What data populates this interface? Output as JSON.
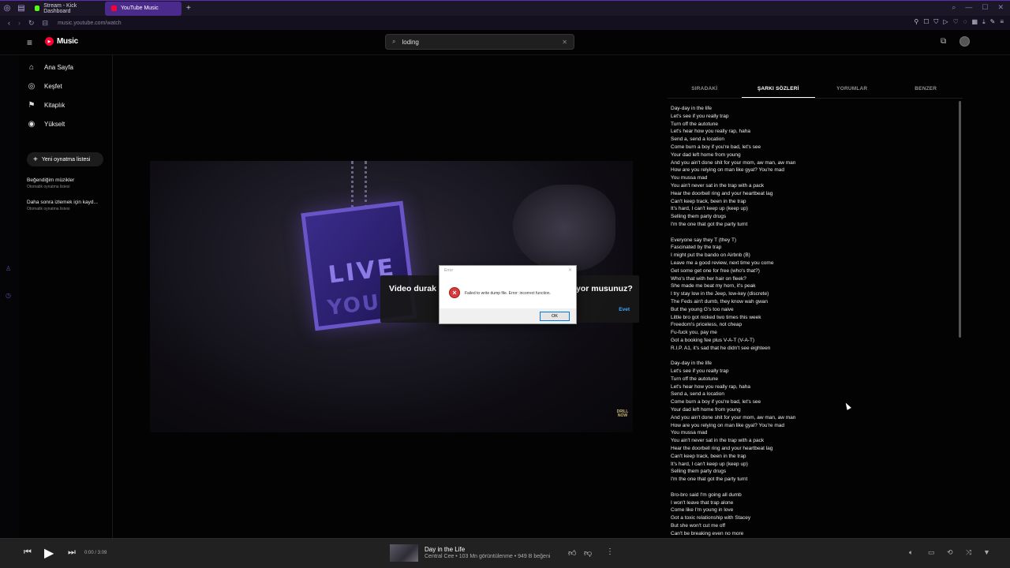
{
  "browser": {
    "tabs": [
      {
        "label": "Stream - Kick Dashboard",
        "color": "#53fc18",
        "active": false
      },
      {
        "label": "YouTube Music",
        "color": "#ff0033",
        "active": true
      }
    ],
    "url": "music.youtube.com/watch"
  },
  "header": {
    "logo_text": "Music",
    "search_value": "loding"
  },
  "sidebar": {
    "items": [
      {
        "label": "Ana Sayfa",
        "icon": "home-icon"
      },
      {
        "label": "Keşfet",
        "icon": "compass-icon"
      },
      {
        "label": "Kitaplık",
        "icon": "library-icon"
      },
      {
        "label": "Yükselt",
        "icon": "upgrade-icon"
      }
    ],
    "new_playlist": "Yeni oynatma listesi",
    "playlists": [
      {
        "title": "Beğendiğim müzikler",
        "subtitle": "Otomatik oynatma listesi"
      },
      {
        "title": "Daha sonra izlemek için kayd...",
        "subtitle": "Otomatik oynatma listesi"
      }
    ]
  },
  "video": {
    "pendant_line1": "LIVE",
    "pendant_line2": "YOU",
    "watermark": "DRILL NOW"
  },
  "pause_overlay": {
    "text_left": "Video durak",
    "text_right": "yor musunuz?",
    "confirm": "Evet"
  },
  "error_dialog": {
    "title": "Error",
    "message": "Failed to write dump file. Error: incorrect function.",
    "ok": "OK"
  },
  "panel": {
    "tabs": [
      "SIRADAKİ",
      "ŞARKI SÖZLERİ",
      "YORUMLAR",
      "BENZER"
    ],
    "active_tab": 1,
    "lyrics": [
      "Day-day in the life",
      "Let's see if you really trap",
      "Turn off the autotune",
      "Let's hear how you really rap, haha",
      "Send a, send a location",
      "Come burn a boy if you're bad, let's see",
      "Your dad left home from young",
      "And you ain't done shit for your mom, aw man, aw man",
      "How are you relying on man like gyal? You're mad",
      "You mussa mad",
      "You ain't never sat in the trap with a pack",
      "Hear the doorbell ring and your heartbeat lag",
      "Can't keep track, been in the trap",
      "It's hard, I can't keep up (keep up)",
      "Selling them party drugs",
      "I'm the one that got the party turnt",
      "",
      "Everyone say they T (they T)",
      "Fascinated by the trap",
      "I might put the bando on Airbnb (B)",
      "Leave me a good review, next time you come",
      "Get some get one for free (who's that?)",
      "Who's that with her hair on fleek?",
      "She made me beat my horn, it's peak",
      "I try stay low in the Jeep, low-key (discrete)",
      "The Feds ain't dumb, they know wah gwan",
      "But the young G's too naive",
      "Little bro got nicked two times this week",
      "Freedom's priceless, not cheap",
      "Fu-fuck you, pay me",
      "Got a booking fee plus V-A-T (V-A-T)",
      "R.I.P. A1, it's sad that he didn't see eighteen",
      "",
      "Day-day in the life",
      "Let's see if you really trap",
      "Turn off the autotune",
      "Let's hear how you really rap, haha",
      "Send a, send a location",
      "Come burn a boy if you're bad, let's see",
      "Your dad left home from young",
      "And you ain't done shit for your mom, aw man, aw man",
      "How are you relying on man like gyal? You're mad",
      "You mussa mad",
      "You ain't never sat in the trap with a pack",
      "Hear the doorbell ring and your heartbeat lag",
      "Can't keep track, been in the trap",
      "It's hard, I can't keep up (keep up)",
      "Selling them party drugs",
      "I'm the one that got the party turnt",
      "",
      "Bro-bro said I'm going all dumb",
      "I won't leave that trap alone",
      "Come like I'm young in love",
      "Got a toxic relationship with Stacey",
      "But she won't cut me off",
      "Can't be breaking even no more"
    ]
  },
  "player": {
    "time": "0:00 / 3:09",
    "song_title": "Day in the Life",
    "song_meta": "Central Cee • 103 Mn görüntülenme • 949 B beğeni"
  },
  "colors": {
    "accent_purple": "#4a2a8a",
    "brand_red": "#ff0033",
    "link_blue": "#3ea6ff"
  }
}
